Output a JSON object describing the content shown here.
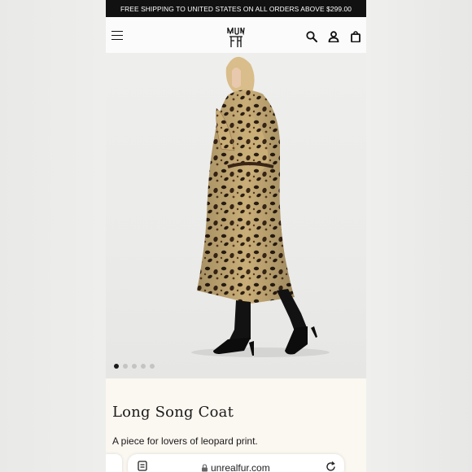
{
  "promo": {
    "text": "FREE SHIPPING TO UNITED STATES ON ALL ORDERS ABOVE $299.00"
  },
  "header": {
    "menu_icon": "hamburger-menu-icon",
    "logo": "unreal-fur-logo",
    "search_icon": "search-icon",
    "account_icon": "user-icon",
    "cart_icon": "shopping-bag-icon"
  },
  "gallery": {
    "image": "model-wearing-leopard-print-faux-fur-coat",
    "slide_count": 5,
    "active_slide": 1
  },
  "product": {
    "title": "Long Song Coat",
    "description": "A piece for lovers of leopard print."
  },
  "browser": {
    "url": "unrealfur.com",
    "tabs_icon": "tabs-icon",
    "lock_icon": "lock-icon",
    "reload_icon": "reload-icon"
  },
  "colors": {
    "promo_bg": "#111111",
    "page_bg": "#fbf7f1",
    "text": "#1a1a1a"
  }
}
